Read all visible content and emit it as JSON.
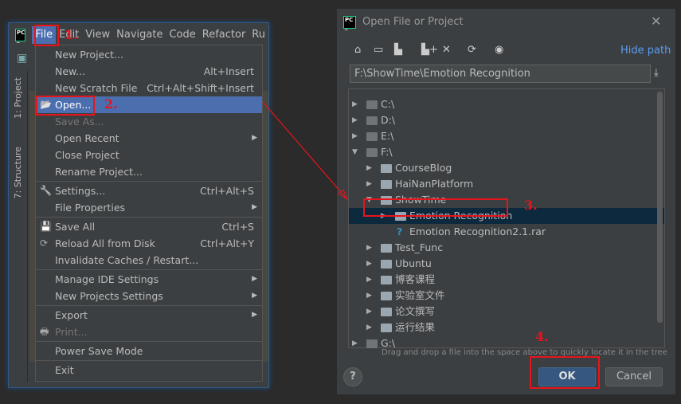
{
  "ide": {
    "menubar": [
      {
        "label": "File",
        "active": true
      },
      {
        "label": "Edit"
      },
      {
        "label": "View"
      },
      {
        "label": "Navigate"
      },
      {
        "label": "Code"
      },
      {
        "label": "Refactor"
      },
      {
        "label": "Ru"
      }
    ],
    "side_tabs": {
      "project": "1: Project",
      "structure": "7: Structure"
    },
    "file_menu": [
      {
        "label": "New Project..."
      },
      {
        "label": "New...",
        "shortcut": "Alt+Insert"
      },
      {
        "label": "New Scratch File",
        "shortcut": "Ctrl+Alt+Shift+Insert"
      },
      {
        "label": "Open...",
        "icon": "folder-open-icon",
        "selected": true
      },
      {
        "label": "Save As...",
        "disabled": true
      },
      {
        "label": "Open Recent",
        "submenu": true
      },
      {
        "label": "Close Project"
      },
      {
        "label": "Rename Project..."
      },
      {
        "label": "Settings...",
        "shortcut": "Ctrl+Alt+S",
        "icon": "wrench-icon"
      },
      {
        "label": "File Properties",
        "submenu": true
      },
      {
        "label": "Save All",
        "shortcut": "Ctrl+S",
        "icon": "save-icon"
      },
      {
        "label": "Reload All from Disk",
        "shortcut": "Ctrl+Alt+Y",
        "icon": "reload-icon"
      },
      {
        "label": "Invalidate Caches / Restart..."
      },
      {
        "label": "Manage IDE Settings",
        "submenu": true
      },
      {
        "label": "New Projects Settings",
        "submenu": true
      },
      {
        "label": "Export",
        "submenu": true
      },
      {
        "label": "Print...",
        "disabled": true,
        "icon": "print-icon"
      },
      {
        "label": "Power Save Mode"
      },
      {
        "label": "Exit"
      }
    ]
  },
  "annotations": {
    "step1": "1.",
    "step2": "2.",
    "step3": "3.",
    "step4": "4.",
    "color": "#e8141c"
  },
  "dialog": {
    "title": "Open File or Project",
    "hide_path": "Hide path",
    "path_value": "F:\\ShowTime\\Emotion Recognition",
    "tree": [
      {
        "label": "C:\\",
        "depth": 0,
        "state": "collapsed",
        "type": "drive"
      },
      {
        "label": "D:\\",
        "depth": 0,
        "state": "collapsed",
        "type": "drive"
      },
      {
        "label": "E:\\",
        "depth": 0,
        "state": "collapsed",
        "type": "drive"
      },
      {
        "label": "F:\\",
        "depth": 0,
        "state": "expanded",
        "type": "drive"
      },
      {
        "label": "CourseBlog",
        "depth": 1,
        "state": "collapsed",
        "type": "folder"
      },
      {
        "label": "HaiNanPlatform",
        "depth": 1,
        "state": "collapsed",
        "type": "folder"
      },
      {
        "label": "ShowTime",
        "depth": 1,
        "state": "expanded",
        "type": "folder"
      },
      {
        "label": "Emotion Recognition",
        "depth": 2,
        "state": "collapsed",
        "type": "folder",
        "selected": true
      },
      {
        "label": "Emotion Recognition2.1.rar",
        "depth": 2,
        "state": "leaf",
        "type": "unknown-file"
      },
      {
        "label": "Test_Func",
        "depth": 1,
        "state": "collapsed",
        "type": "folder"
      },
      {
        "label": "Ubuntu",
        "depth": 1,
        "state": "collapsed",
        "type": "folder"
      },
      {
        "label": "博客课程",
        "depth": 1,
        "state": "collapsed",
        "type": "folder"
      },
      {
        "label": "实验室文件",
        "depth": 1,
        "state": "collapsed",
        "type": "folder"
      },
      {
        "label": "论文撰写",
        "depth": 1,
        "state": "collapsed",
        "type": "folder"
      },
      {
        "label": "运行结果",
        "depth": 1,
        "state": "collapsed",
        "type": "folder"
      },
      {
        "label": "G:\\",
        "depth": 0,
        "state": "collapsed",
        "type": "drive"
      }
    ],
    "hint": "Drag and drop a file into the space above to quickly locate it in the tree",
    "ok": "OK",
    "cancel": "Cancel",
    "help": "?"
  }
}
